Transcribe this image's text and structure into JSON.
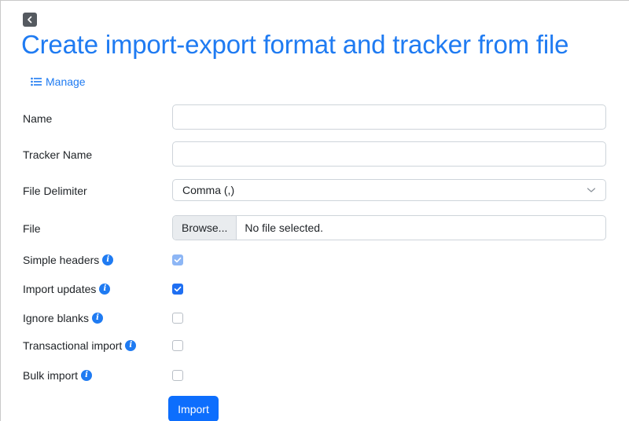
{
  "header": {
    "title": "Create import-export format and tracker from file",
    "manage_label": "Manage"
  },
  "form": {
    "name": {
      "label": "Name",
      "value": "",
      "placeholder": ""
    },
    "tracker_name": {
      "label": "Tracker Name",
      "value": "",
      "placeholder": ""
    },
    "file_delimiter": {
      "label": "File Delimiter",
      "selected": "Comma (,)"
    },
    "file": {
      "label": "File",
      "browse_label": "Browse...",
      "status": "No file selected."
    },
    "options": [
      {
        "label": "Simple headers",
        "checked": true,
        "disabled": true
      },
      {
        "label": "Import updates",
        "checked": true,
        "disabled": false
      },
      {
        "label": "Ignore blanks",
        "checked": false,
        "disabled": false
      },
      {
        "label": "Transactional import",
        "checked": false,
        "disabled": false
      },
      {
        "label": "Bulk import",
        "checked": false,
        "disabled": false
      }
    ],
    "submit_label": "Import"
  },
  "icons": {
    "back": "chevron-left-icon",
    "manage": "list-icon",
    "info": "info-icon",
    "dropdown": "chevron-down-icon",
    "check": "check-icon"
  },
  "colors": {
    "accent": "#1f7bf2",
    "button": "#0d6efd",
    "checked": "#1f6ff2",
    "checked_disabled": "#8db6f5"
  }
}
